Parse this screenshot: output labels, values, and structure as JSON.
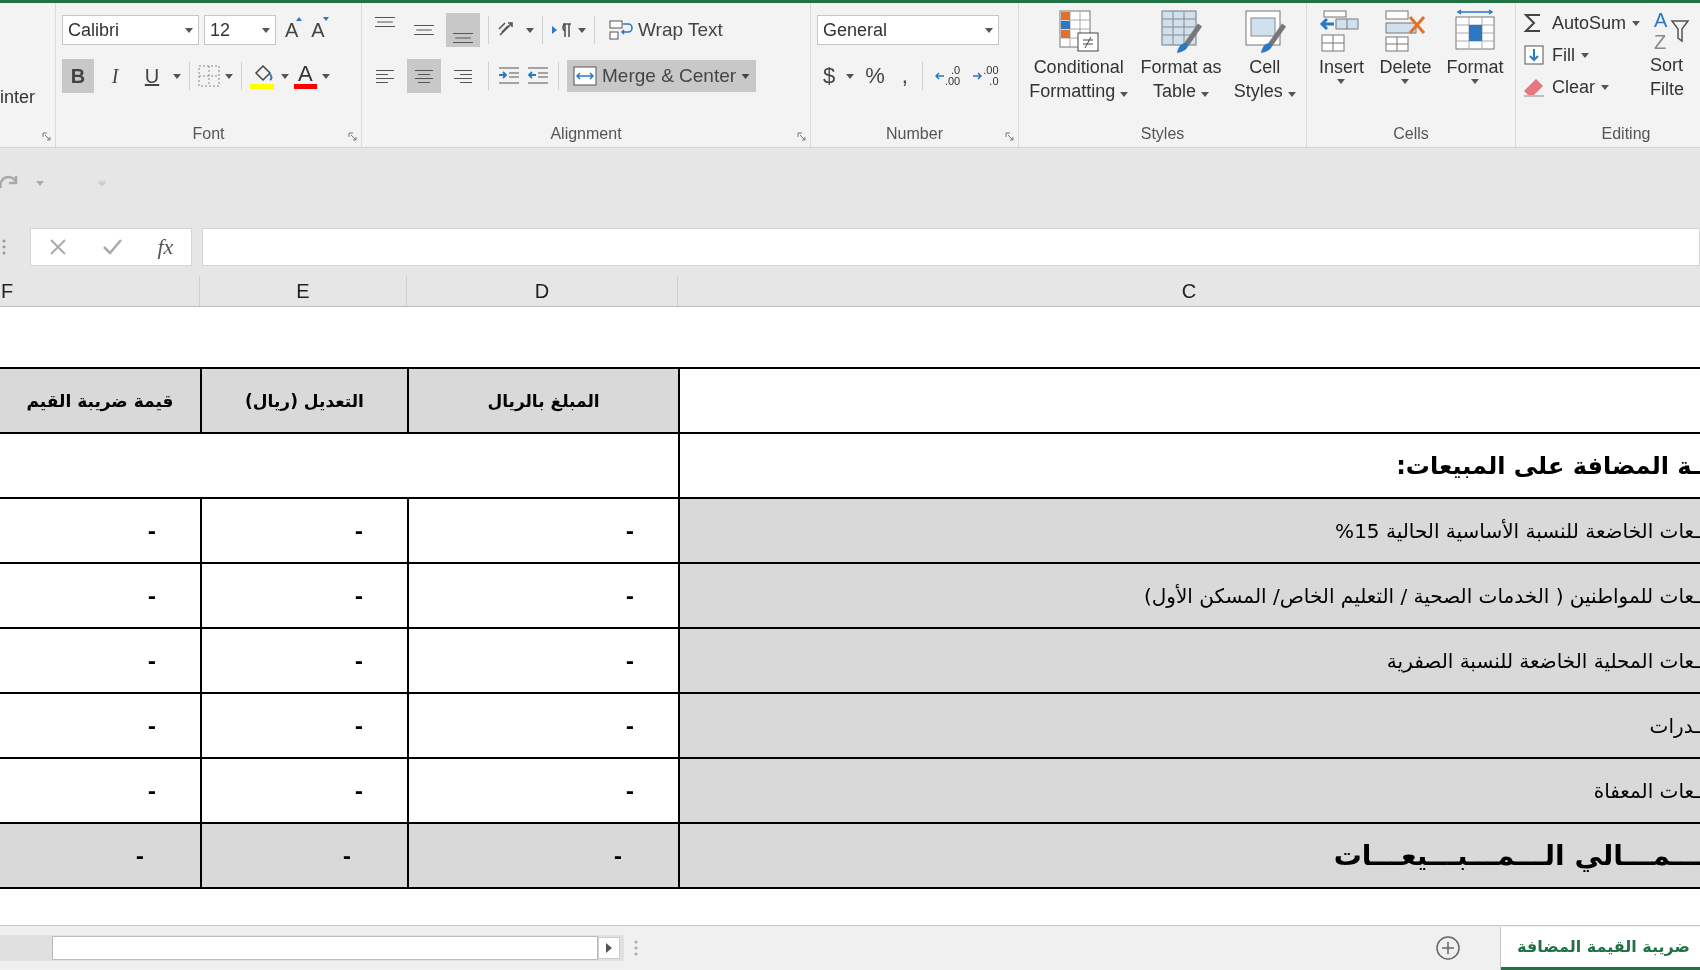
{
  "ribbon": {
    "clipboard": {
      "format_painter": "inter"
    },
    "font": {
      "label": "Font",
      "name": "Calibri",
      "size": "12",
      "grow": "A",
      "shrink": "A",
      "font_color_glyph": "A",
      "styles": [
        {
          "kind": "bold",
          "text": "B",
          "selected": true
        },
        {
          "kind": "italic",
          "text": "I",
          "selected": false
        },
        {
          "kind": "underline",
          "text": "U",
          "selected": false
        }
      ]
    },
    "alignment": {
      "label": "Alignment",
      "vertical": [
        {
          "kind": "top",
          "selected": false
        },
        {
          "kind": "middle",
          "selected": false
        },
        {
          "kind": "bottom",
          "selected": true
        }
      ],
      "horizontal": [
        {
          "kind": "left",
          "selected": false
        },
        {
          "kind": "center",
          "selected": true
        },
        {
          "kind": "right",
          "selected": false
        }
      ],
      "wrap_text": {
        "label": "Wrap Text",
        "selected": false
      },
      "merge": {
        "label": "Merge & Center",
        "selected": true
      }
    },
    "number": {
      "label": "Number",
      "format": "General",
      "symbols": [
        "$",
        "%",
        ","
      ],
      "decimals": [
        {
          "kind": "increase",
          "top": ".0",
          "bottom": ".00"
        },
        {
          "kind": "decrease",
          "top": ".00",
          "bottom": ".0"
        }
      ]
    },
    "styles": {
      "label": "Styles",
      "items": [
        {
          "kind": "conditional",
          "lines": [
            "Conditional",
            "Formatting"
          ]
        },
        {
          "kind": "table",
          "lines": [
            "Format as",
            "Table"
          ]
        },
        {
          "kind": "cell",
          "lines": [
            "Cell",
            "Styles"
          ]
        }
      ]
    },
    "cells": {
      "label": "Cells",
      "items": [
        {
          "kind": "insert",
          "label": "Insert"
        },
        {
          "kind": "delete",
          "label": "Delete"
        },
        {
          "kind": "format",
          "label": "Format"
        }
      ]
    },
    "editing": {
      "label": "Editing",
      "items": [
        {
          "kind": "autosum",
          "label": "AutoSum"
        },
        {
          "kind": "fill",
          "label": "Fill"
        },
        {
          "kind": "clear",
          "label": "Clear"
        }
      ],
      "sort": {
        "letters": [
          "A",
          "Z"
        ],
        "lines": [
          "Sort",
          "Filte"
        ]
      }
    }
  },
  "formula_bar": {
    "function_label": "fx"
  },
  "columns": [
    {
      "label": "F"
    },
    {
      "label": "E"
    },
    {
      "label": "D"
    },
    {
      "label": "C"
    }
  ],
  "table": {
    "headers": [
      "المبلغ بالريال",
      "التعديل (ريال)",
      "قيمة ضريبة القيم"
    ],
    "section_title": "ـة المضافة على المبيعات:",
    "rows": [
      {
        "label": "ـعات الخاضعة للنسبة الأساسية الحالية 15%",
        "values": [
          "-",
          "-",
          "-"
        ]
      },
      {
        "label": "ـعات للمواطنين ( الخدمات الصحية / التعليم الخاص/ المسكن الأول)",
        "values": [
          "-",
          "-",
          "-"
        ]
      },
      {
        "label": "ـعات المحلية الخاضعة للنسبة الصفرية",
        "values": [
          "-",
          "-",
          "-"
        ]
      },
      {
        "label": "ـدرات",
        "values": [
          "-",
          "-",
          "-"
        ]
      },
      {
        "label": "ـعات المعفاة",
        "values": [
          "-",
          "-",
          "-"
        ]
      }
    ],
    "total": {
      "label": "ـــمـــالي الـــمـــبـــيعـــات",
      "values": [
        "-",
        "-",
        "-"
      ]
    }
  },
  "sheet_tabs": [
    {
      "label": "ضريبة القيمة المضافة",
      "selected": true
    }
  ]
}
